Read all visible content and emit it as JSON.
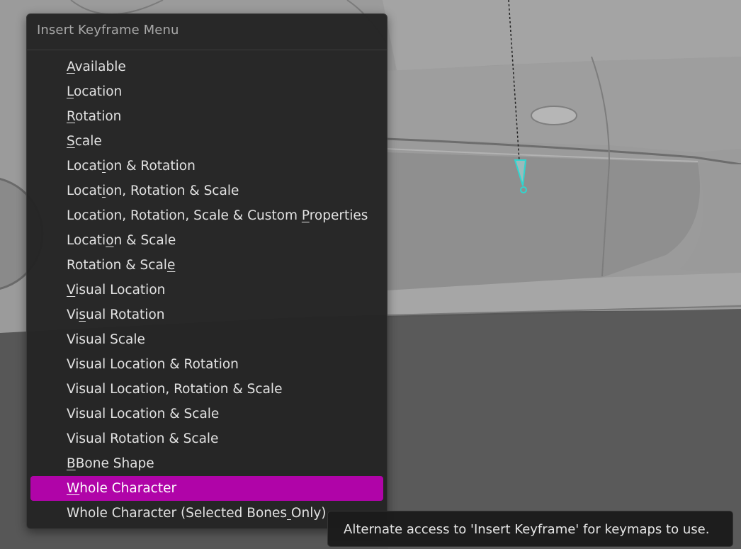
{
  "menu": {
    "title": "Insert Keyframe Menu",
    "items": [
      {
        "label": "Available",
        "underline": 0
      },
      {
        "label": "Location",
        "underline": 0
      },
      {
        "label": "Rotation",
        "underline": 0
      },
      {
        "label": "Scale",
        "underline": 0
      },
      {
        "label": "Location & Rotation",
        "underline": 5
      },
      {
        "label": "Location, Rotation & Scale",
        "underline": 5
      },
      {
        "label": "Location, Rotation, Scale & Custom Properties",
        "underline": 35
      },
      {
        "label": "Location & Scale",
        "underline": 6
      },
      {
        "label": "Rotation & Scale",
        "underline": 15
      },
      {
        "label": "Visual Location",
        "underline": 0
      },
      {
        "label": "Visual Rotation",
        "underline": 2
      },
      {
        "label": "Visual Scale",
        "underline": -1
      },
      {
        "label": "Visual Location & Rotation",
        "underline": -1
      },
      {
        "label": "Visual Location, Rotation & Scale",
        "underline": -1
      },
      {
        "label": "Visual Location & Scale",
        "underline": -1
      },
      {
        "label": "Visual Rotation & Scale",
        "underline": -1
      },
      {
        "label": "BBone Shape",
        "underline": 0
      },
      {
        "label": "Whole Character",
        "underline": 0,
        "active": true
      },
      {
        "label": "Whole Character (Selected Bones Only)",
        "underline": 31
      }
    ],
    "highlight_color": "#b004a8"
  },
  "tooltip": {
    "text": "Alternate access to 'Insert Keyframe' for keymaps to use."
  },
  "viewport": {
    "background_color": "#595959",
    "bone_color": "#2fd6d0"
  }
}
